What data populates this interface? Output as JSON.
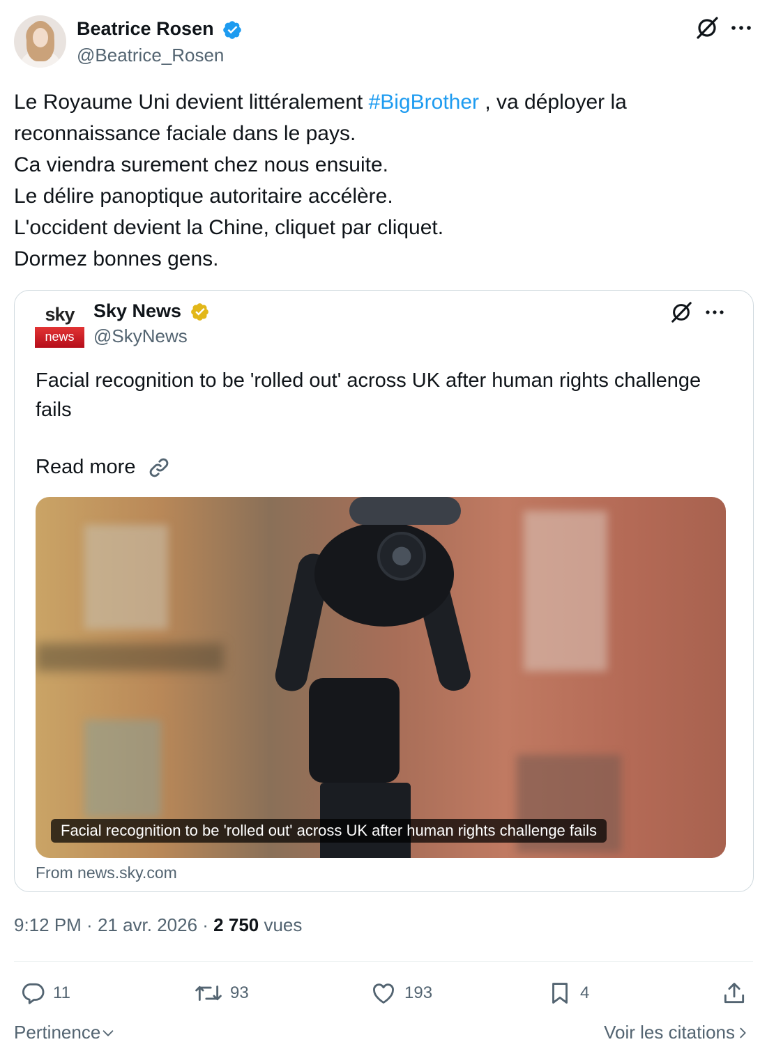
{
  "author": {
    "name": "Beatrice Rosen",
    "handle": "@Beatrice_Rosen",
    "verified_color": "#1d9bf0"
  },
  "tweet": {
    "text_before": "Le Royaume Uni devient littéralement ",
    "hashtag": "#BigBrother",
    "text_after": " , va déployer la\nreconnaissance faciale dans le pays.\nCa viendra surement chez nous ensuite.\nLe délire panoptique autoritaire accélère.\nL'occident devient la Chine, cliquet par cliquet.\nDormez bonnes gens."
  },
  "quote": {
    "logo_top": "sky",
    "logo_bottom": "news",
    "name": "Sky News",
    "handle": "@SkyNews",
    "verified_color": "#e2b719",
    "text": "Facial recognition to be 'rolled out' across UK after human rights challenge fails",
    "read_more": "Read more",
    "media_caption": "Facial recognition to be 'rolled out' across UK after human rights challenge fails",
    "source": "From news.sky.com"
  },
  "meta": {
    "time": "9:12 PM",
    "separator": " · ",
    "date": "21 avr. 2026",
    "views_count": "2 750",
    "views_label": " vues"
  },
  "actions": {
    "replies": "11",
    "retweets": "93",
    "likes": "193",
    "bookmarks": "4"
  },
  "footer": {
    "sort_label": "Pertinence",
    "quotes_label": "Voir les citations"
  }
}
